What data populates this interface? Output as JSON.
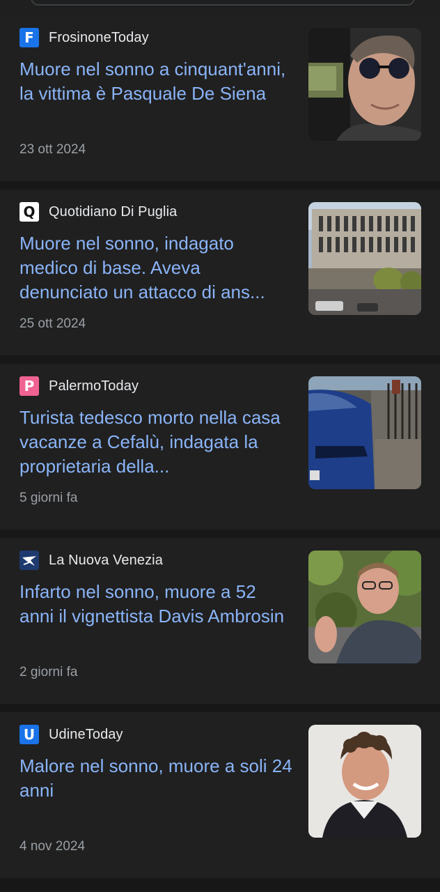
{
  "colors": {
    "background": "#171717",
    "card": "#202020",
    "headline": "#8ab4f8",
    "source": "#e8eaed",
    "date": "#9aa0a6"
  },
  "articles": [
    {
      "source": "FrosinoneToday",
      "favicon_letter": "F",
      "favicon_color": "#1a73e8",
      "headline": "Muore nel sonno a cinquant'anni, la vittima è Pasquale De Siena",
      "date": "23 ott 2024",
      "thumbnail_icon": "man-sunglasses-photo"
    },
    {
      "source": "Quotidiano Di Puglia",
      "favicon_letter": "Q",
      "favicon_color": "#ffffff",
      "headline": "Muore nel sonno, indagato medico di base. Aveva denunciato un attacco di ans...",
      "date": "25 ott 2024",
      "thumbnail_icon": "building-photo"
    },
    {
      "source": "PalermoToday",
      "favicon_letter": "P",
      "favicon_color": "#f06292",
      "headline": "Turista tedesco morto nella casa vacanze a Cefalù, indagata la proprietaria della...",
      "date": "5 giorni fa",
      "thumbnail_icon": "police-car-photo"
    },
    {
      "source": "La Nuova Venezia",
      "favicon_letter": "",
      "favicon_color": "#1e3a6e",
      "headline": "Infarto nel sonno, muore a 52 anni il vignettista Davis Ambrosin",
      "date": "2 giorni fa",
      "thumbnail_icon": "man-waving-photo"
    },
    {
      "source": "UdineToday",
      "favicon_letter": "U",
      "favicon_color": "#1a73e8",
      "headline": "Malore nel sonno, muore a soli 24 anni",
      "date": "4 nov 2024",
      "thumbnail_icon": "young-man-photo"
    }
  ]
}
